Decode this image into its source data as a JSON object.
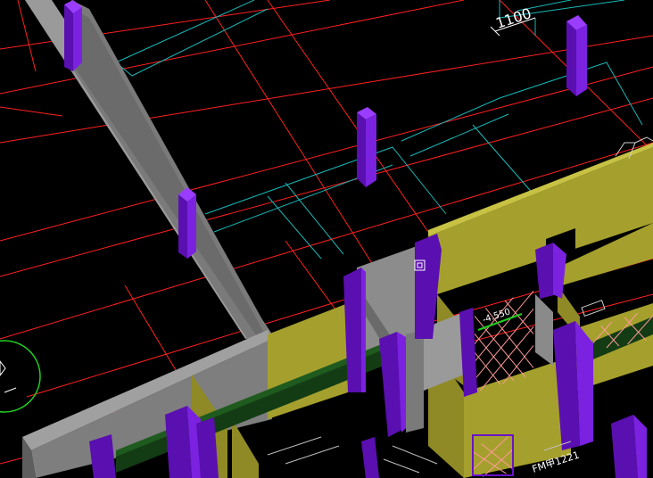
{
  "window": {
    "title": ""
  },
  "colors": {
    "background": "#000000",
    "axis_grid": "#ff2020",
    "cyan_lines": "#19b7b7",
    "wall_gray": "#8c8c8c",
    "wall_gray_dark": "#5a5a5a",
    "wall_olive": "#a5a02d",
    "wall_olive_dark": "#6b6818",
    "column_purple": "#6a12c8",
    "column_purple_light": "#9a3dff",
    "beam_green": "#143c14",
    "pattern_pink": "#ff9a9a",
    "level_green": "#22cc22",
    "text_white": "#ffffff"
  },
  "annotations": {
    "dimension_1100": "1100",
    "level_mark": "-4.550",
    "door_tag": "FM甲1221"
  },
  "cursor": {
    "icon": "osnap-center-square-icon"
  }
}
